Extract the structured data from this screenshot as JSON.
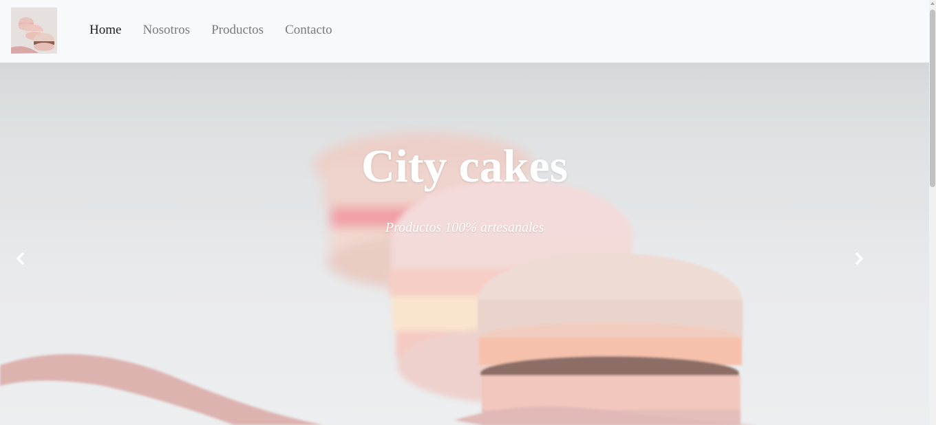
{
  "navbar": {
    "logo_icon": "macaron-logo-image",
    "links": [
      {
        "label": "Home",
        "active": true
      },
      {
        "label": "Nosotros",
        "active": false
      },
      {
        "label": "Productos",
        "active": false
      },
      {
        "label": "Contacto",
        "active": false
      }
    ]
  },
  "hero": {
    "title": "City cakes",
    "subtitle": "Productos 100% artesanales",
    "prev_icon": "chevron-left-icon",
    "next_icon": "chevron-right-icon"
  },
  "colors": {
    "navbar_bg": "#f8f9fa",
    "nav_active": "#1f1f1f",
    "nav_inactive": "#7b7b7b",
    "hero_text": "#ffffff"
  }
}
